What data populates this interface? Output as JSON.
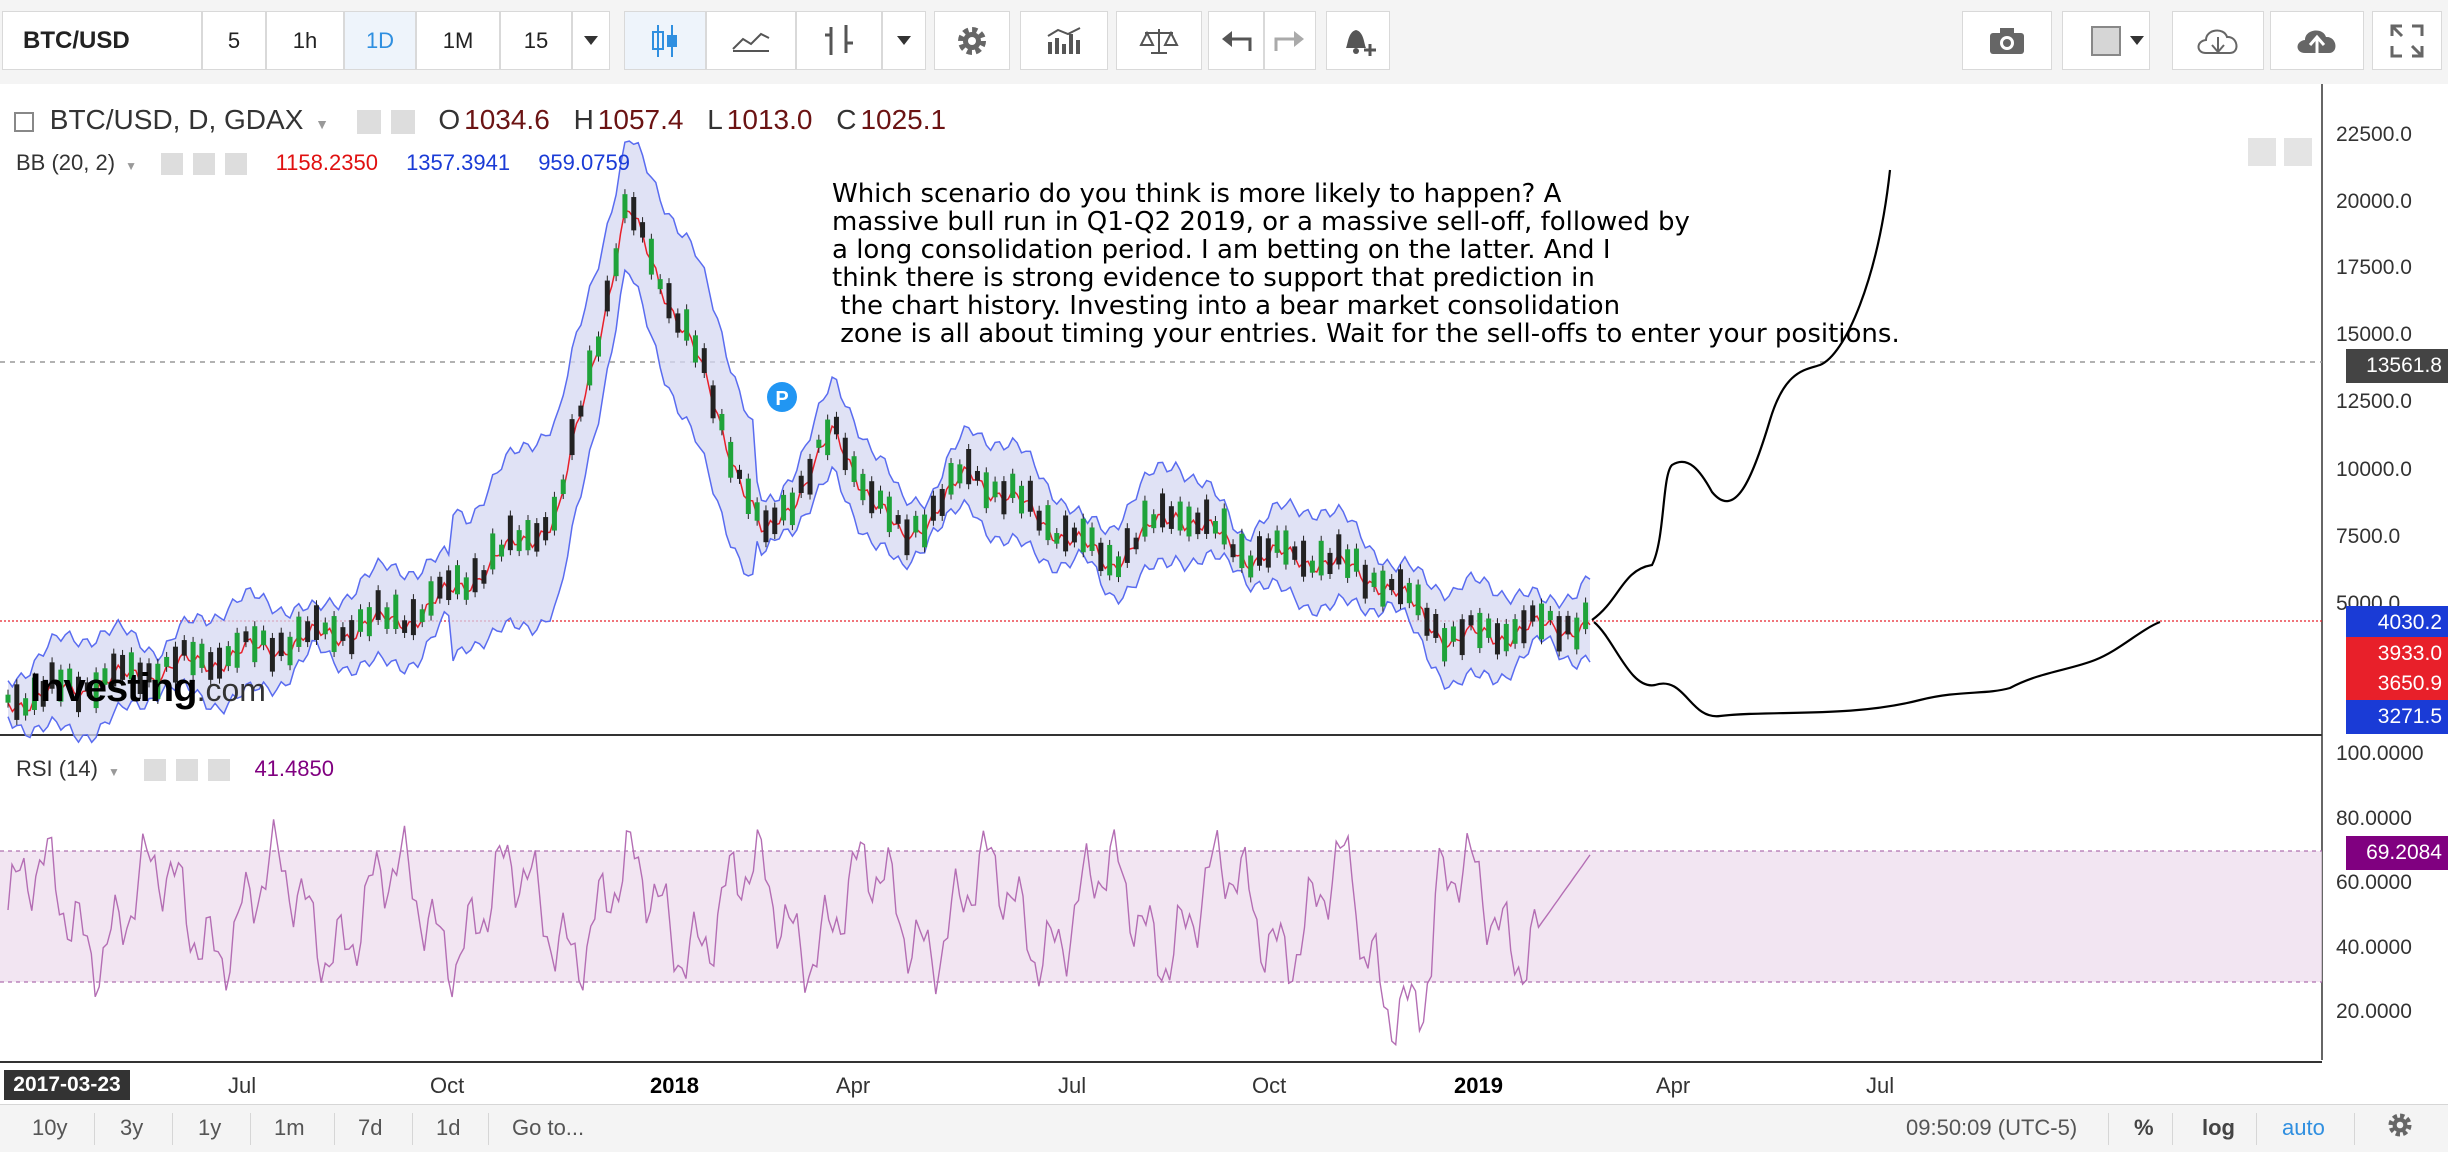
{
  "toolbar": {
    "symbol": "BTC/USD",
    "intervals": [
      "5",
      "1h",
      "1D",
      "1M",
      "15"
    ],
    "active_interval": "1D"
  },
  "main_legend": {
    "title": "BTC/USD, D, GDAX",
    "open_label": "O",
    "open": "1034.6",
    "high_label": "H",
    "high": "1057.4",
    "low_label": "L",
    "low": "1013.0",
    "close_label": "C",
    "close": "1025.1"
  },
  "bb_legend": {
    "label": "BB (20, 2)",
    "basis": "1158.2350",
    "upper": "1357.3941",
    "lower": "959.0759",
    "basis_color": "#e01010",
    "upper_color": "#1a3bd6",
    "lower_color": "#1a3bd6"
  },
  "rsi_legend": {
    "label": "RSI (14)",
    "value": "41.4850",
    "color": "#800080"
  },
  "annotation": "Which scenario do you think is more likely to happen? A\nmassive bull run in Q1-Q2 2019, or a massive sell-off, followed by\na long consolidation period. I am betting on the latter. And I\nthink there is strong evidence to support that prediction in\n the chart history. Investing into a bear market consolidation\n zone is all about timing your entries. Wait for the sell-offs to enter your positions.",
  "price_axis": [
    "22500.0",
    "20000.0",
    "17500.0",
    "15000.0",
    "12500.0",
    "10000.0",
    "7500.0",
    "5000.0"
  ],
  "price_labels": [
    {
      "text": "13561.8",
      "color": "#444444"
    },
    {
      "text": "4030.2",
      "color": "#1a3bd6"
    },
    {
      "text": "3933.0",
      "color": "#e8202a"
    },
    {
      "text": "3650.9",
      "color": "#e8202a"
    },
    {
      "text": "3271.5",
      "color": "#1a3bd6"
    }
  ],
  "rsi_axis": [
    "100.0000",
    "80.0000",
    "60.0000",
    "40.0000",
    "20.0000"
  ],
  "rsi_label": {
    "text": "69.2084",
    "color": "#800080"
  },
  "time_axis": {
    "start_label": "2017-03-23",
    "ticks": [
      {
        "text": "Jul",
        "bold": false
      },
      {
        "text": "Oct",
        "bold": false
      },
      {
        "text": "2018",
        "bold": true
      },
      {
        "text": "Apr",
        "bold": false
      },
      {
        "text": "Jul",
        "bold": false
      },
      {
        "text": "Oct",
        "bold": false
      },
      {
        "text": "2019",
        "bold": true
      },
      {
        "text": "Apr",
        "bold": false
      },
      {
        "text": "Jul",
        "bold": false
      }
    ]
  },
  "watermark": {
    "brand": "Investing",
    "suffix": ".com"
  },
  "bottombar": {
    "ranges": [
      "10y",
      "3y",
      "1y",
      "1m",
      "7d",
      "1d"
    ],
    "goto": "Go to...",
    "clock": "09:50:09 (UTC-5)",
    "percent": "%",
    "log": "log",
    "auto": "auto"
  },
  "chart_data": {
    "type": "candlestick",
    "symbol": "BTC/USD",
    "interval": "D",
    "exchange": "GDAX",
    "x_range": [
      "2017-03-23",
      "2019-07"
    ],
    "ylim": [
      3271.5,
      22500
    ],
    "approx_path": [
      [
        "2017-03",
        1000
      ],
      [
        "2017-06",
        2600
      ],
      [
        "2017-09",
        4300
      ],
      [
        "2017-11",
        8000
      ],
      [
        "2017-12",
        19500
      ],
      [
        "2018-01",
        14000
      ],
      [
        "2018-02",
        7000
      ],
      [
        "2018-03",
        11000
      ],
      [
        "2018-04",
        7000
      ],
      [
        "2018-05",
        9600
      ],
      [
        "2018-07",
        6200
      ],
      [
        "2018-08",
        8200
      ],
      [
        "2018-09",
        6500
      ],
      [
        "2018-10",
        6400
      ],
      [
        "2018-11",
        5500
      ],
      [
        "2018-12",
        3300
      ],
      [
        "2019-01",
        3700
      ],
      [
        "2019-02",
        3950
      ]
    ],
    "indicators": [
      "BB (20, 2)",
      "RSI (14)"
    ],
    "rsi_last": 69.2084,
    "rsi_bands": [
      30,
      70
    ]
  }
}
